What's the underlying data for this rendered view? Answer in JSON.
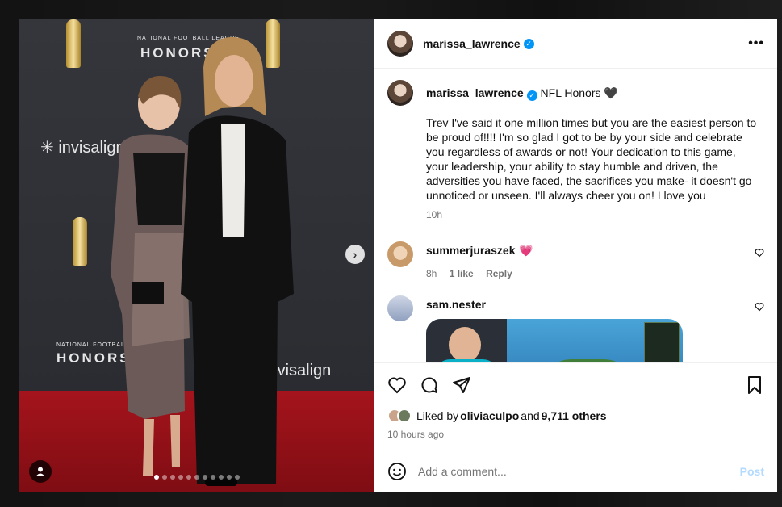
{
  "post": {
    "username": "marissa_lawrence",
    "more_icon": "more-horizontal-icon"
  },
  "photo": {
    "logo_top": "NATIONAL FOOTBALL LEAGUE",
    "logo_honors": "HONORS",
    "sponsor": "invisalign",
    "carousel_count": 11,
    "carousel_active": 0
  },
  "caption": {
    "username": "marissa_lawrence",
    "title": "NFL Honors 🖤",
    "text": "Trev I've said it one million times but you are the easiest person to be proud of!!!! I'm so glad I got to be by your side and celebrate you regardless of awards or not! Your dedication to this game, your leadership, your ability to stay humble and driven, the adversities you have faced, the sacrifices you make- it doesn't go unnoticed or unseen. I'll always cheer you on! I love you",
    "time": "10h"
  },
  "comments": [
    {
      "username": "summerjuraszek",
      "text": "💗",
      "time": "8h",
      "likes": "1 like",
      "reply": "Reply"
    },
    {
      "username": "sam.nester"
    }
  ],
  "likes": {
    "prefix": "Liked by ",
    "user": "oliviaculpo",
    "and": " and ",
    "count": "9,711 others"
  },
  "posted_time": "10 hours ago",
  "add_comment": {
    "placeholder": "Add a comment...",
    "post_label": "Post"
  },
  "colors": {
    "verified": "#0095f6",
    "post_button": "#b3dbff",
    "heart": "#ff3b6b"
  }
}
